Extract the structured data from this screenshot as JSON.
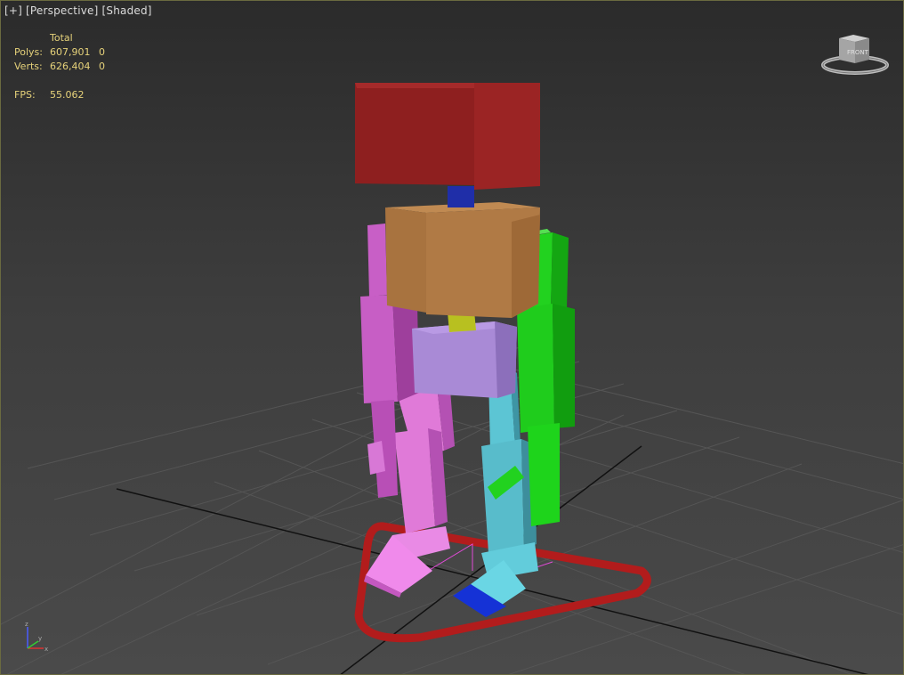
{
  "viewport": {
    "label_plus": "[+]",
    "label_view": "[Perspective]",
    "label_shading": "[Shaded]"
  },
  "stats": {
    "header": "Total",
    "polys_label": "Polys:",
    "polys_total": "607,901",
    "polys_selected": "0",
    "verts_label": "Verts:",
    "verts_total": "626,404",
    "verts_selected": "0",
    "fps_label": "FPS:",
    "fps_value": "55.062"
  },
  "viewcube": {
    "face_label": "FRONT"
  },
  "axis_tripod": {
    "z": "z",
    "y": "y",
    "x": "x"
  },
  "colors": {
    "head": "#8e1f1f",
    "neck": "#1f2ea8",
    "chest": "#b07a45",
    "pelvis": "#a98ad6",
    "left_limbs": "#d46ad1",
    "right_arm": "#22d21f",
    "right_leg": "#52b8c8",
    "ground_ring": "#b21c1c"
  }
}
